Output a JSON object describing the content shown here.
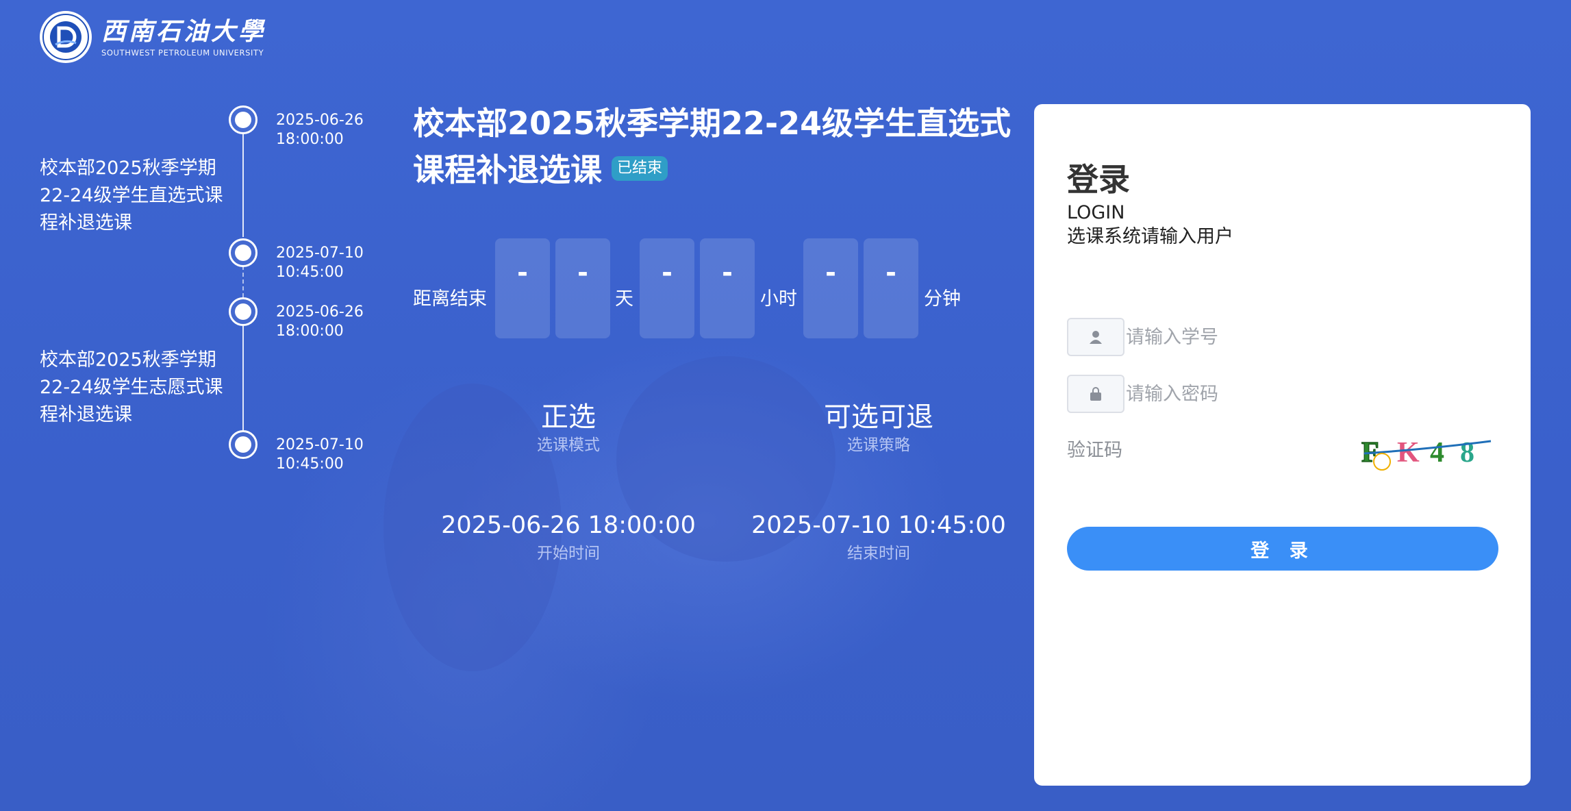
{
  "header": {
    "logo_cn": "西南石油大學",
    "logo_en": "SOUTHWEST PETROLEUM UNIVERSITY"
  },
  "timeline": [
    {
      "title": "校本部2025秋季学期22-24级学生直选式课程补退选课",
      "start": "2025-06-26 18:00:00",
      "end": "2025-07-10 10:45:00"
    },
    {
      "title": "校本部2025秋季学期22-24级学生志愿式课程补退选课",
      "start": "2025-06-26 18:00:00",
      "end": "2025-07-10 10:45:00"
    }
  ],
  "course": {
    "title": "校本部2025秋季学期22-24级学生直选式课程补退选课",
    "status_badge": "已结束",
    "countdown": {
      "label": "距离结束",
      "day_digits": [
        "-",
        "-"
      ],
      "day_unit": "天",
      "hour_digits": [
        "-",
        "-"
      ],
      "hour_unit": "小时",
      "minute_digits": [
        "-",
        "-"
      ],
      "minute_unit": "分钟"
    },
    "mode": {
      "value": "正选",
      "label": "选课模式"
    },
    "strategy": {
      "value": "可选可退",
      "label": "选课策略"
    },
    "start": {
      "value": "2025-06-26 18:00:00",
      "label": "开始时间"
    },
    "end": {
      "value": "2025-07-10 10:45:00",
      "label": "结束时间"
    }
  },
  "login": {
    "title": "登录",
    "subtitle_en": "LOGIN",
    "subtitle_cn": "选课系统请输入用户",
    "username_placeholder": "请输入学号",
    "password_placeholder": "请输入密码",
    "captcha_label": "验证码",
    "captcha_text": "FK48",
    "submit_label": "登 录"
  },
  "colors": {
    "background": "#3c63cf",
    "badge": "#2f9ec7",
    "login_button": "#3a8ff7",
    "panel": "#ffffff"
  }
}
